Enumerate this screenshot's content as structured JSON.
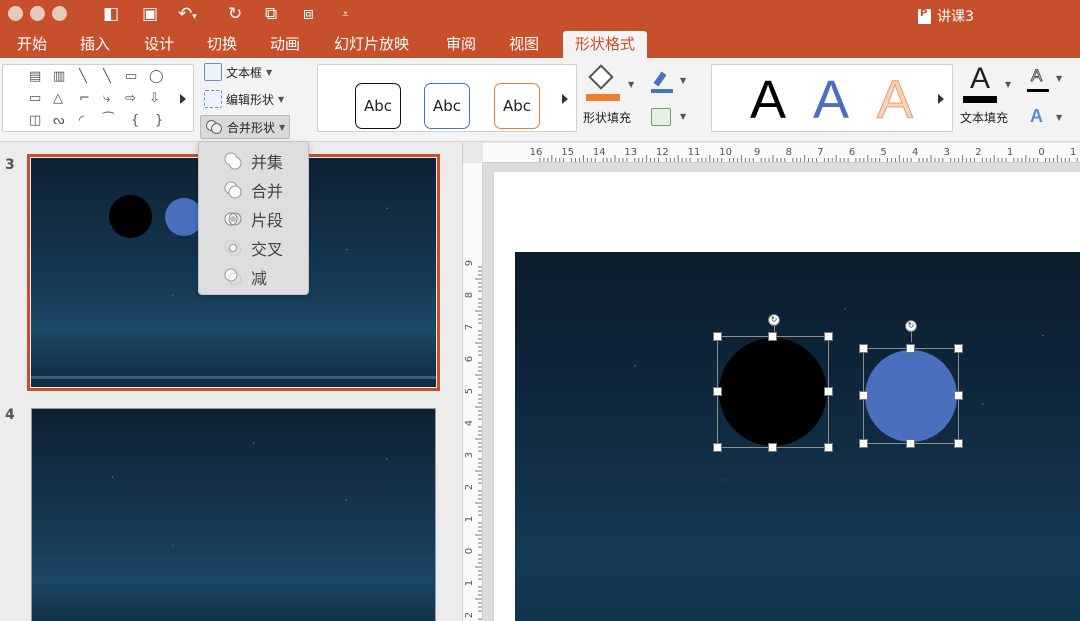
{
  "window": {
    "doc_title": "讲课3",
    "colors": {
      "accent": "#c6502b",
      "ribbon_bg": "#f3f3f3"
    }
  },
  "quick_access": {
    "icons": [
      "sidebar-toggle-icon",
      "save-icon",
      "undo-icon",
      "redo-icon",
      "copy-icon",
      "paste-icon",
      "customize-icon"
    ]
  },
  "tabs": [
    {
      "label": "开始"
    },
    {
      "label": "插入"
    },
    {
      "label": "设计"
    },
    {
      "label": "切换"
    },
    {
      "label": "动画"
    },
    {
      "label": "幻灯片放映"
    },
    {
      "label": "审阅"
    },
    {
      "label": "视图"
    },
    {
      "label": "形状格式",
      "active": true
    }
  ],
  "ribbon": {
    "insert_shapes": {
      "shape_glyphs": [
        "▤",
        "▥",
        "╲",
        "╲",
        "▭",
        "◯",
        "▭",
        "△",
        "⌐",
        "⤷",
        "⇨",
        "⇩",
        "◫",
        "ᔓ",
        "◜",
        "⁀",
        "{",
        "}"
      ]
    },
    "text_box_label": "文本框",
    "edit_shape_label": "编辑形状",
    "merge_shapes_label": "合并形状",
    "style_swatches": [
      {
        "label": "Abc",
        "border": "#111111"
      },
      {
        "label": "Abc",
        "border": "#4472c4"
      },
      {
        "label": "Abc",
        "border": "#ed7d31"
      }
    ],
    "shape_fill_label": "形状填充",
    "wordart": [
      {
        "letter": "A",
        "color": "#000000"
      },
      {
        "letter": "A",
        "color": "#4a6fbf"
      },
      {
        "letter": "A",
        "color": "#f4b183"
      }
    ],
    "text_fill_label": "文本填充"
  },
  "merge_menu": {
    "items": [
      {
        "label": "并集",
        "icon": "union-icon"
      },
      {
        "label": "合并",
        "icon": "combine-icon"
      },
      {
        "label": "片段",
        "icon": "fragment-icon"
      },
      {
        "label": "交叉",
        "icon": "intersect-icon"
      },
      {
        "label": "减",
        "icon": "subtract-icon"
      }
    ]
  },
  "thumbnails": [
    {
      "number": "3",
      "selected": true
    },
    {
      "number": "4",
      "selected": false
    }
  ],
  "rulers": {
    "horizontal_labels": [
      "16",
      "15",
      "14",
      "13",
      "12",
      "11",
      "10",
      "9",
      "8",
      "7",
      "6",
      "5",
      "4",
      "3",
      "2",
      "1",
      "0",
      "1"
    ],
    "vertical_labels": [
      "9",
      "8",
      "7",
      "6",
      "5",
      "4",
      "3",
      "2",
      "1",
      "0",
      "1",
      "2"
    ]
  },
  "slide": {
    "shapes": [
      {
        "name": "black-circle",
        "color": "#000000",
        "selected": true
      },
      {
        "name": "blue-circle",
        "color": "#4a6fbf",
        "selected": true
      }
    ]
  }
}
